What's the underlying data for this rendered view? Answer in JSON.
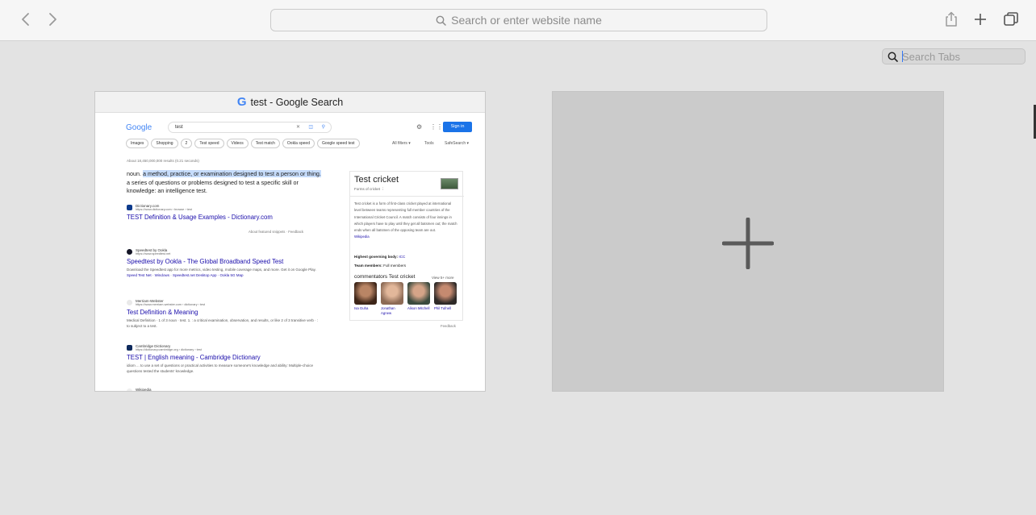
{
  "toolbar": {
    "address_placeholder": "Search or enter website name"
  },
  "search_tabs": {
    "placeholder": "Search Tabs"
  },
  "tab": {
    "title": "test - Google Search",
    "favicon": "G",
    "google": {
      "logo": "Google",
      "query": "test",
      "signin": "Sign in",
      "chips": [
        "Images",
        "Shopping",
        "2",
        "Test speed",
        "Videos",
        "Test match",
        "Ookla speed",
        "Google speed test"
      ],
      "all_filters": "All filters ▾",
      "tools": "Tools",
      "safesearch": "SafeSearch ▾",
      "stats": "About 18,450,000,000 results (0.21 seconds)",
      "definition_pre": "noun. ",
      "definition_highlight": "a method, practice, or examination designed to test a person or thing.",
      "definition_post": " a series of questions or problems designed to test a specific skill or knowledge: an intelligence test.",
      "feedback_row": "About featured snippets  ·  Feedback",
      "results": [
        {
          "site": "Dictionary.com",
          "url": "https://www.dictionary.com › browse › test",
          "title": "TEST Definition & Usage Examples - Dictionary.com",
          "snippet": "",
          "links": ""
        },
        {
          "site": "Speedtest by Ookla",
          "url": "https://www.speedtest.net",
          "title": "Speedtest by Ookla - The Global Broadband Speed Test",
          "snippet": "Download the Speedtest app for more metrics, video testing, mobile coverage maps, and more. Get it on Google Play.",
          "links": "Speed Test Net · Windows · Speedtest.net Desktop App · Ookla 5G Map"
        },
        {
          "site": "Merriam-Webster",
          "url": "https://www.merriam-webster.com › dictionary › test",
          "title": "Test Definition & Meaning",
          "snippet": "Medical Definition · 1 of 3 noun · test. 1. : a critical examination, observation, and results, or like 2 of 3 transitive verb · : to subject to a test.",
          "links": ""
        },
        {
          "site": "Cambridge Dictionary",
          "url": "https://dictionary.cambridge.org › dictionary › test",
          "title": "TEST | English meaning - Cambridge Dictionary",
          "snippet": "idiom ... to use a set of questions or practical activities to measure someone's knowledge and ability: Multiple-choice questions tested the students' knowledge.",
          "links": ""
        },
        {
          "site": "Wikipedia",
          "url": "",
          "title": "",
          "snippet": "",
          "links": ""
        }
      ],
      "knowledge_panel": {
        "title": "Test cricket",
        "subtitle": "Forms of cricket ⋮",
        "description": "Test cricket is a form of first-class cricket played at international level between teams representing full member countries of the International Cricket Council. A match consists of four innings in which players have to play until they get all batsmen out; the match ends when all batsmen of the opposing team are out.",
        "wiki_link": "Wikipedia",
        "fact1_label": "Highest governing body: ",
        "fact1_value": "ICC",
        "fact2_label": "Team members: ",
        "fact2_value": "Full members",
        "commentators_title": "commentators Test cricket",
        "view_more": "View 5+ more",
        "people": [
          {
            "name": "Isa Guha",
            "color": "#7a4a33"
          },
          {
            "name": "Jonathan Agnew",
            "color": "#c99b7d"
          },
          {
            "name": "Alison Mitchell",
            "color": "#5c6b5e"
          },
          {
            "name": "Phil Tufnell",
            "color": "#8a5a45"
          }
        ],
        "feedback": "Feedback"
      }
    }
  },
  "colors": {
    "accent": "#3478f6",
    "link": "#1a0dab",
    "signin": "#1a73e8"
  }
}
